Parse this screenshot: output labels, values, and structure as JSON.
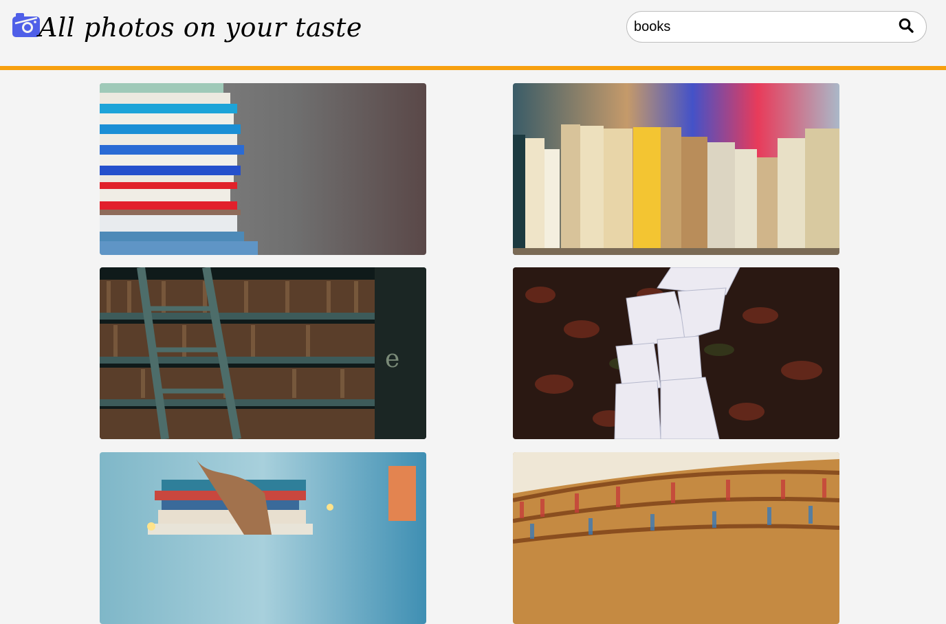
{
  "header": {
    "title": "All photos on your taste",
    "logo_icon": "camera-icon",
    "accent_color": "#f7a00f",
    "logo_color": "#4f5fe8"
  },
  "search": {
    "value": "books",
    "button_icon": "search-icon"
  },
  "gallery": {
    "photos": [
      {
        "subject": "stack-of-colorful-books-icon"
      },
      {
        "subject": "row-of-old-books-icon"
      },
      {
        "subject": "library-shelf-with-ladder-icon"
      },
      {
        "subject": "open-books-on-autumn-leaves-icon"
      },
      {
        "subject": "books-tied-with-ribbon-icon"
      },
      {
        "subject": "curved-library-bookshelves-icon"
      }
    ]
  }
}
